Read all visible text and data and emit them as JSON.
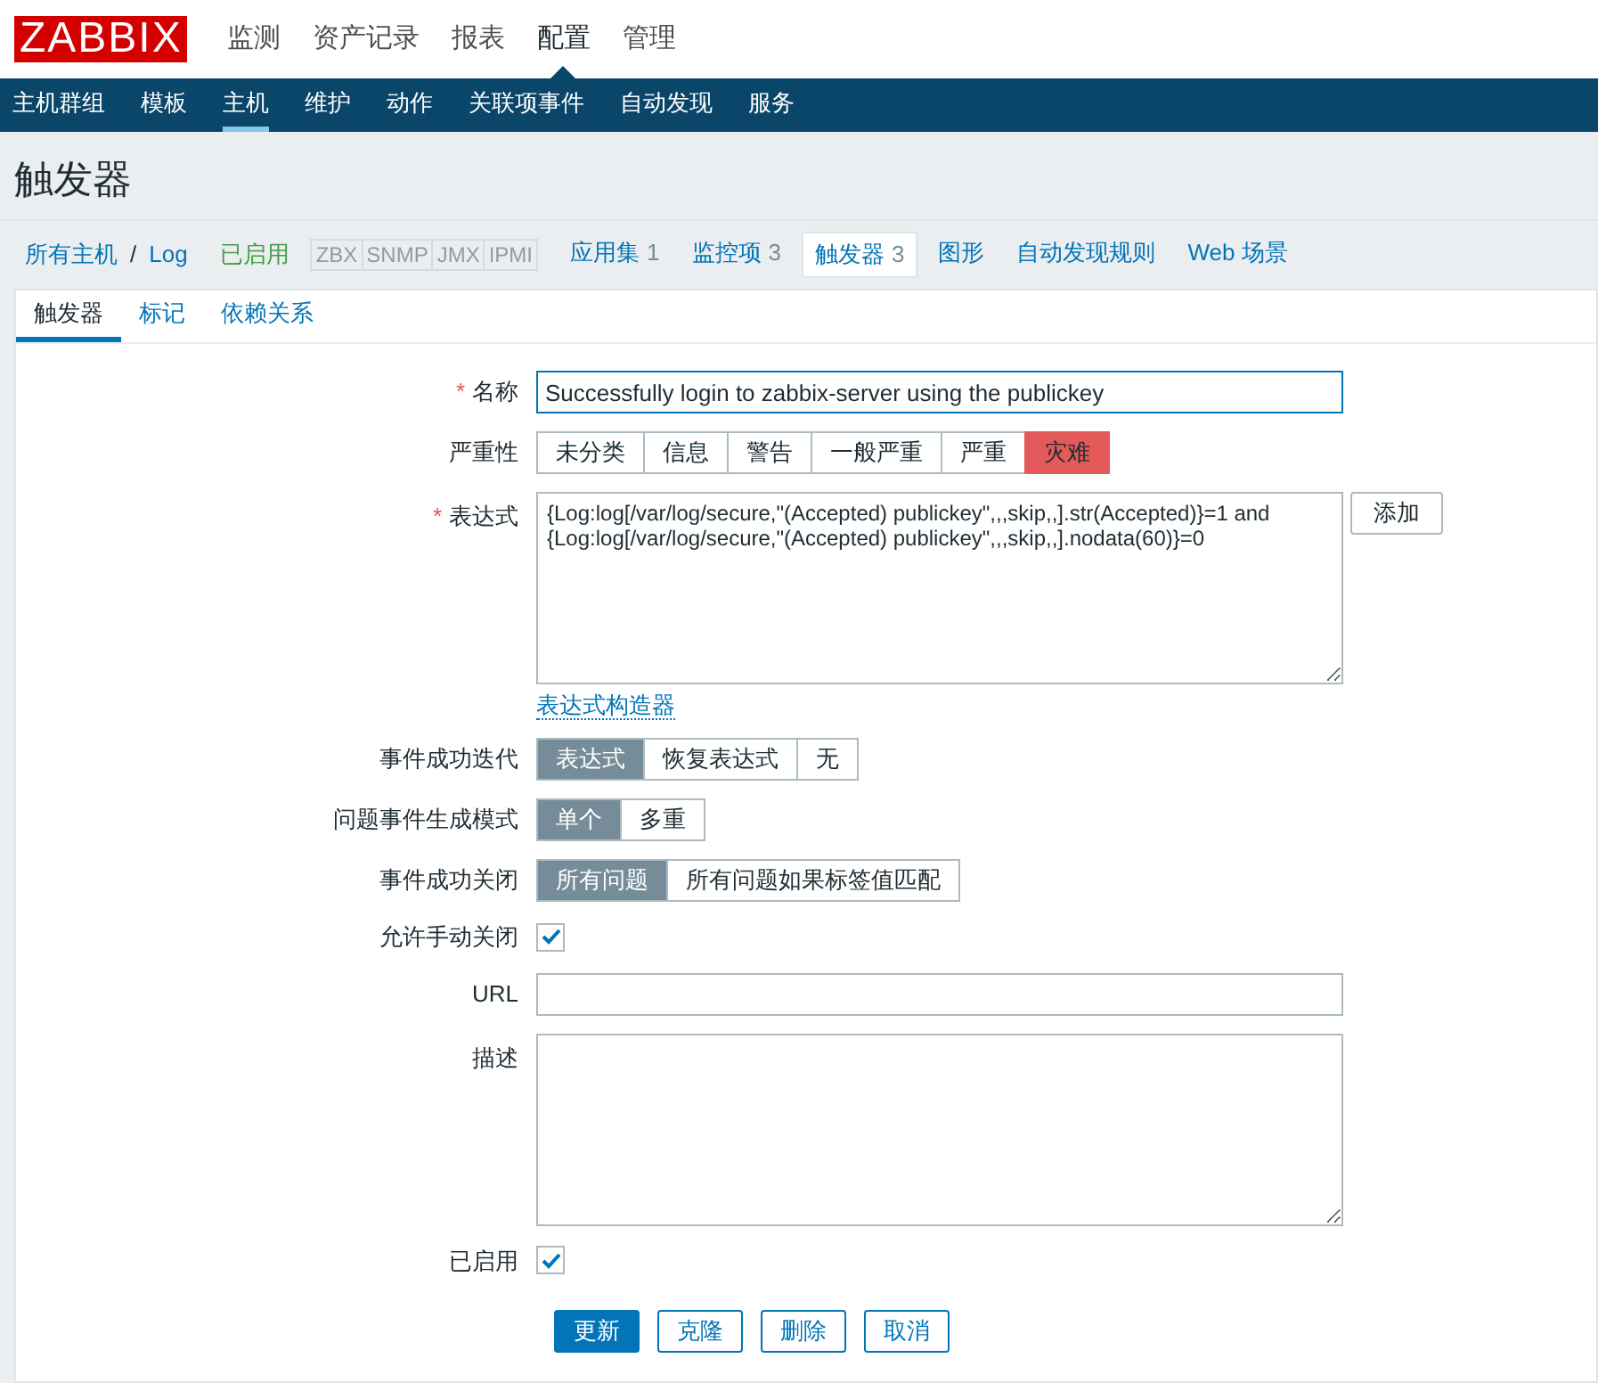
{
  "header": {
    "logo": "ZABBIX",
    "menu": [
      {
        "label": "监测",
        "selected": false
      },
      {
        "label": "资产记录",
        "selected": false
      },
      {
        "label": "报表",
        "selected": false
      },
      {
        "label": "配置",
        "selected": true
      },
      {
        "label": "管理",
        "selected": false
      }
    ]
  },
  "sub_menu": [
    {
      "label": "主机群组",
      "selected": false
    },
    {
      "label": "模板",
      "selected": false
    },
    {
      "label": "主机",
      "selected": true
    },
    {
      "label": "维护",
      "selected": false
    },
    {
      "label": "动作",
      "selected": false
    },
    {
      "label": "关联项事件",
      "selected": false
    },
    {
      "label": "自动发现",
      "selected": false
    },
    {
      "label": "服务",
      "selected": false
    }
  ],
  "page_title": "触发器",
  "breadcrumb": {
    "all_hosts": "所有主机",
    "separator": "/",
    "host": "Log",
    "status": "已启用",
    "availability": [
      "ZBX",
      "SNMP",
      "JMX",
      "IPMI"
    ],
    "tabs": [
      {
        "label": "应用集",
        "count": "1",
        "selected": false
      },
      {
        "label": "监控项",
        "count": "3",
        "selected": false
      },
      {
        "label": "触发器",
        "count": "3",
        "selected": true
      },
      {
        "label": "图形",
        "selected": false
      },
      {
        "label": "自动发现规则",
        "selected": false
      },
      {
        "label": "Web 场景",
        "selected": false
      }
    ]
  },
  "form_tabs": [
    {
      "label": "触发器",
      "selected": true
    },
    {
      "label": "标记",
      "selected": false
    },
    {
      "label": "依赖关系",
      "selected": false
    }
  ],
  "form": {
    "rows": [
      {
        "kind": "input",
        "required_mark": "*",
        "label": "名称",
        "value": "Successfully login to zabbix-server using the publickey",
        "focused": true
      },
      {
        "kind": "segmented",
        "label": "严重性",
        "options": [
          {
            "label": "未分类",
            "selected": false
          },
          {
            "label": "信息",
            "selected": false
          },
          {
            "label": "警告",
            "selected": false
          },
          {
            "label": "一般严重",
            "selected": false
          },
          {
            "label": "严重",
            "selected": false
          },
          {
            "label": "灾难",
            "selected": true,
            "color": "#e45959"
          }
        ]
      },
      {
        "kind": "expression",
        "required_mark": "*",
        "label": "表达式",
        "lines": [
          "{Log:log[/var/log/secure,\"(Accepted) publickey\",,,skip,,].str(Accepted)}=1 and",
          "{Log:log[/var/log/secure,\"(Accepted) publickey\",,,skip,,].nodata(60)}=0"
        ],
        "add_button": "添加",
        "link": "表达式构造器"
      },
      {
        "kind": "segmented",
        "label": "事件成功迭代",
        "options": [
          {
            "label": "表达式",
            "selected": true
          },
          {
            "label": "恢复表达式",
            "selected": false
          },
          {
            "label": "无",
            "selected": false
          }
        ]
      },
      {
        "kind": "segmented",
        "label": "问题事件生成模式",
        "options": [
          {
            "label": "单个",
            "selected": true
          },
          {
            "label": "多重",
            "selected": false
          }
        ]
      },
      {
        "kind": "segmented",
        "label": "事件成功关闭",
        "options": [
          {
            "label": "所有问题",
            "selected": true
          },
          {
            "label": "所有问题如果标签值匹配",
            "selected": false
          }
        ]
      },
      {
        "kind": "checkbox",
        "label": "允许手动关闭",
        "checked": true
      },
      {
        "kind": "input",
        "label": "URL",
        "value": "",
        "focused": false
      },
      {
        "kind": "textarea",
        "label": "描述"
      },
      {
        "kind": "checkbox",
        "label": "已启用",
        "checked": true
      }
    ],
    "buttons": [
      {
        "label": "更新",
        "kind": "primary"
      },
      {
        "label": "克隆",
        "kind": "secondary"
      },
      {
        "label": "删除",
        "kind": "secondary"
      },
      {
        "label": "取消",
        "kind": "secondary"
      }
    ]
  }
}
